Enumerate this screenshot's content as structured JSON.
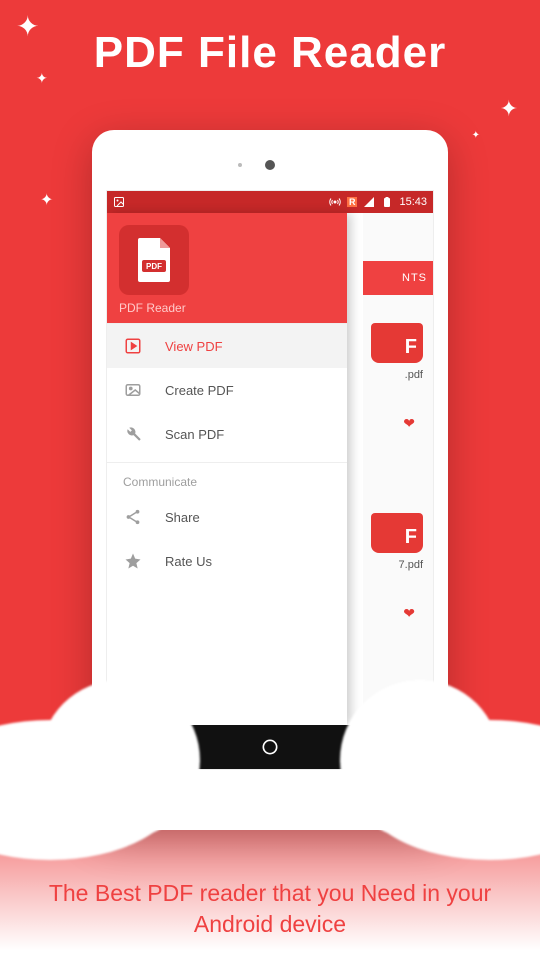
{
  "promo": {
    "title": "PDF File Reader",
    "tagline": "The Best PDF reader that you Need in your Android device"
  },
  "status": {
    "time": "15:43",
    "roaming_label": "R"
  },
  "drawer": {
    "app_name": "PDF Reader",
    "app_icon_badge": "PDF",
    "section_label": "Communicate",
    "items": [
      {
        "key": "view",
        "label": "View PDF",
        "icon": "play-icon",
        "selected": true
      },
      {
        "key": "create",
        "label": "Create PDF",
        "icon": "image-icon",
        "selected": false
      },
      {
        "key": "scan",
        "label": "Scan PDF",
        "icon": "wrench-icon",
        "selected": false
      }
    ],
    "communicate": [
      {
        "key": "share",
        "label": "Share",
        "icon": "share-icon"
      },
      {
        "key": "rate",
        "label": "Rate Us",
        "icon": "star-icon"
      }
    ]
  },
  "background": {
    "tab_hint": "NTS",
    "files": [
      {
        "badge": "F",
        "name": ".pdf"
      },
      {
        "badge": "F",
        "name": "7.pdf"
      }
    ]
  }
}
